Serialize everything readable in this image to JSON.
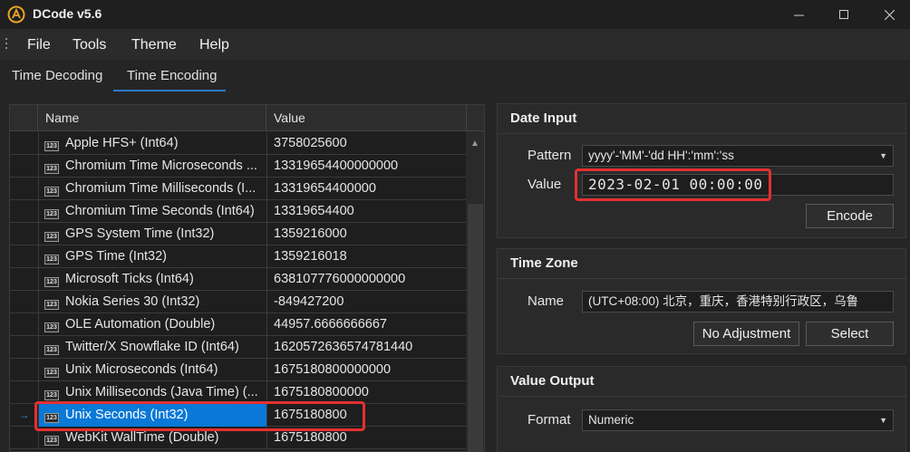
{
  "app": {
    "title": "DCode v5.6"
  },
  "window": {
    "minimize_icon": "minimize-icon",
    "maximize_icon": "maximize-icon",
    "close_icon": "close-icon"
  },
  "menu": [
    "File",
    "Tools",
    "Theme",
    "Help"
  ],
  "tabs": [
    {
      "label": "Time Decoding",
      "active": false
    },
    {
      "label": "Time Encoding",
      "active": true
    }
  ],
  "grid": {
    "columns": [
      "Name",
      "Value"
    ],
    "rows": [
      {
        "name": "Apple HFS+ (Int64)",
        "value": "3758025600"
      },
      {
        "name": "Chromium Time Microseconds ...",
        "value": "13319654400000000"
      },
      {
        "name": "Chromium Time Milliseconds (I...",
        "value": "13319654400000"
      },
      {
        "name": "Chromium Time Seconds (Int64)",
        "value": "13319654400"
      },
      {
        "name": "GPS System Time (Int32)",
        "value": "1359216000"
      },
      {
        "name": "GPS Time (Int32)",
        "value": "1359216018"
      },
      {
        "name": "Microsoft Ticks (Int64)",
        "value": "638107776000000000"
      },
      {
        "name": "Nokia Series 30 (Int32)",
        "value": "-849427200"
      },
      {
        "name": "OLE Automation (Double)",
        "value": "44957.6666666667"
      },
      {
        "name": "Twitter/X Snowflake ID (Int64)",
        "value": "1620572636574781440"
      },
      {
        "name": "Unix Microseconds (Int64)",
        "value": "1675180800000000"
      },
      {
        "name": "Unix Milliseconds (Java Time) (...",
        "value": "1675180800000"
      },
      {
        "name": "Unix Seconds (Int32)",
        "value": "1675180800",
        "selected": true
      },
      {
        "name": "WebKit WallTime (Double)",
        "value": "1675180800"
      }
    ],
    "row_icon_text": "123",
    "current_row_marker": "→"
  },
  "date_input": {
    "title": "Date Input",
    "pattern_label": "Pattern",
    "pattern_value": "yyyy'-'MM'-'dd HH':'mm':'ss",
    "value_label": "Value",
    "value": "2023-02-01 00:00:00",
    "encode_button": "Encode"
  },
  "time_zone": {
    "title": "Time Zone",
    "name_label": "Name",
    "name_value": "(UTC+08:00) 北京，重庆，香港特别行政区，乌鲁",
    "no_adjustment_button": "No Adjustment",
    "select_button": "Select"
  },
  "value_output": {
    "title": "Value Output",
    "format_label": "Format",
    "format_value": "Numeric"
  },
  "colors": {
    "accent": "#0a78d7",
    "highlight": "#e53030",
    "background": "#252526"
  }
}
